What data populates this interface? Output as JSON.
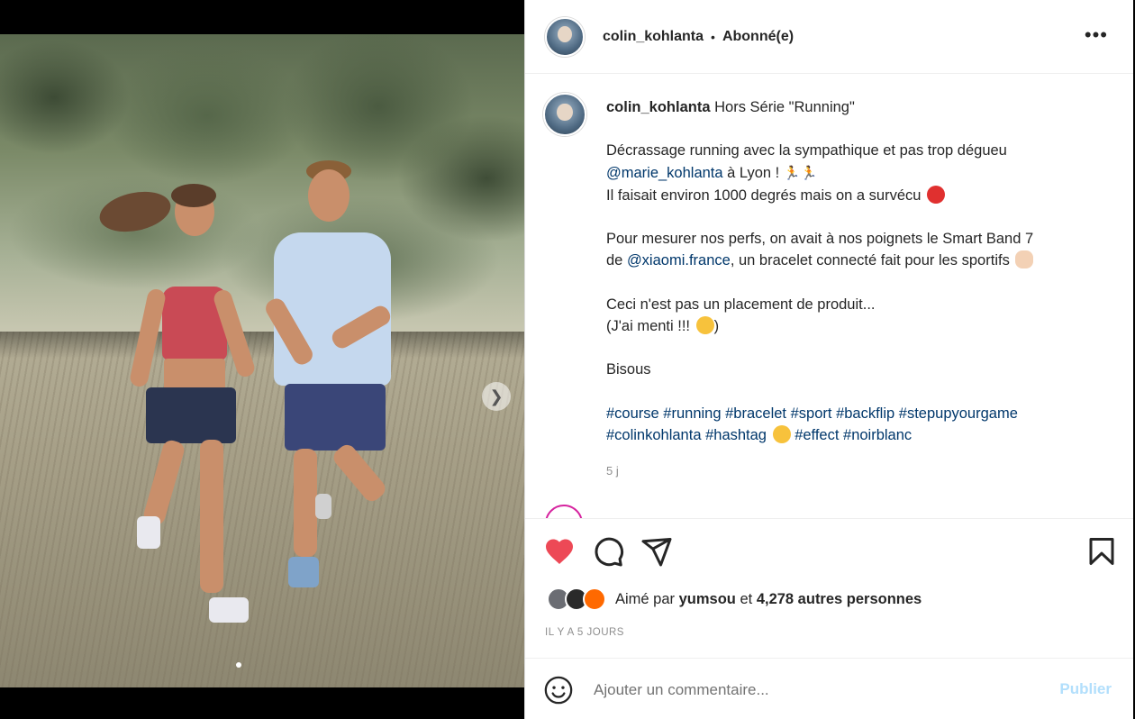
{
  "post": {
    "author": "colin_kohlanta",
    "separator": "•",
    "follow_status": "Abonné(e)",
    "more_icon": "more-horizontal-icon",
    "caption": {
      "username": "colin_kohlanta",
      "title": " Hors Série \"Running\"",
      "p1_l1": "Décrassage running avec la sympathique et pas trop dégueu",
      "p1_mention": "@marie_kohlanta",
      "p1_l2_rest": " à Lyon ! ",
      "p1_l3": "Il faisait environ 1000 degrés mais on a survécu ",
      "p2_l1": "Pour mesurer nos perfs, on avait à nos poignets le Smart Band 7",
      "p2_de": "de ",
      "p2_mention": "@xiaomi.france",
      "p2_rest": ", un bracelet connecté fait pour les sportifs ",
      "p3_l1": "Ceci n'est pas un placement de produit...",
      "p3_l2": "(J'ai menti !!! ",
      "p3_l2_end": ")",
      "p4": "Bisous",
      "hashtags_l1": [
        "#course",
        "#running",
        "#bracelet",
        "#sport",
        "#backflip",
        "#stepupyourgame"
      ],
      "hashtags_l2": [
        "#colinkohlanta",
        "#hashtag"
      ],
      "hashtags_l2_after": [
        "#effect",
        "#noirblanc"
      ]
    },
    "time_ago": "5 j",
    "likes": {
      "prefix": "Aimé par ",
      "user": "yumsou",
      "middle": " et ",
      "count": "4,278 autres personnes"
    },
    "date": "IL Y A 5 JOURS",
    "comment_placeholder": "Ajouter un commentaire...",
    "publish_label": "Publier"
  },
  "colors": {
    "like": "#ed4956",
    "link": "#00376b",
    "publish_disabled": "#b2dffc",
    "muted": "#8e8e8e"
  },
  "icons": [
    "heart-icon",
    "comment-icon",
    "share-icon",
    "bookmark-icon",
    "emoji-icon",
    "chevron-right-icon"
  ]
}
